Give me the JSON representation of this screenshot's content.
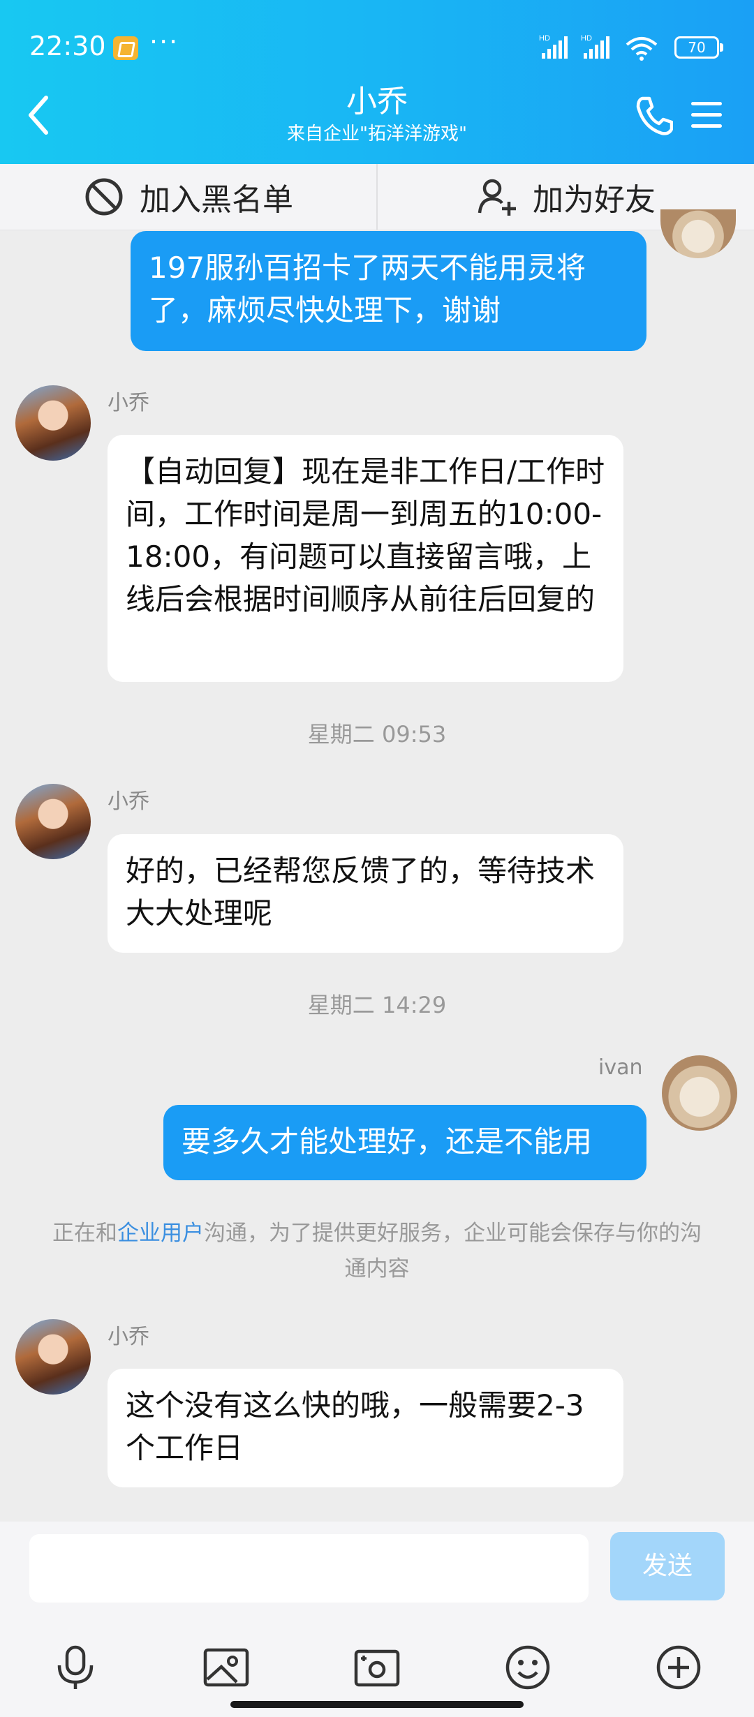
{
  "status_bar": {
    "time": "22:30",
    "more": "···",
    "battery": "70",
    "hd1": "HD",
    "hd2": "HD"
  },
  "header": {
    "title": "小乔",
    "subtitle": "来自企业\"拓洋洋游戏\""
  },
  "actions": {
    "block": "加入黑名单",
    "add_friend": "加为好友"
  },
  "messages": {
    "m1": {
      "text": "197服孙百招卡了两天不能用灵将了，麻烦尽快处理下，谢谢"
    },
    "m2": {
      "sender": "小乔",
      "text": "【自动回复】现在是非工作日/工作时间，工作时间是周一到周五的10:00-18:00，有问题可以直接留言哦，上线后会根据时间顺序从前往后回复的"
    },
    "t1": "星期二 09:53",
    "m3": {
      "sender": "小乔",
      "text": "好的，已经帮您反馈了的，等待技术大大处理呢"
    },
    "t2": "星期二 14:29",
    "m4": {
      "sender": "ivan",
      "text": "要多久才能处理好，还是不能用"
    },
    "notice": {
      "pre": "正在和",
      "link": "企业用户",
      "post": "沟通，为了提供更好服务，企业可能会保存与你的沟通内容"
    },
    "m5": {
      "sender": "小乔",
      "text": "这个没有这么快的哦，一般需要2-3个工作日"
    }
  },
  "input": {
    "value": "",
    "send": "发送"
  },
  "colors": {
    "header_start": "#18c8f2",
    "header_end": "#1aa0f5",
    "bubble_out": "#1a9cf5",
    "send_disabled": "#a3d6fa"
  },
  "icons": [
    "back-icon",
    "phone-icon",
    "menu-icon",
    "block-icon",
    "add-friend-icon",
    "mic-icon",
    "image-icon",
    "camera-icon",
    "emoji-icon",
    "plus-icon"
  ]
}
